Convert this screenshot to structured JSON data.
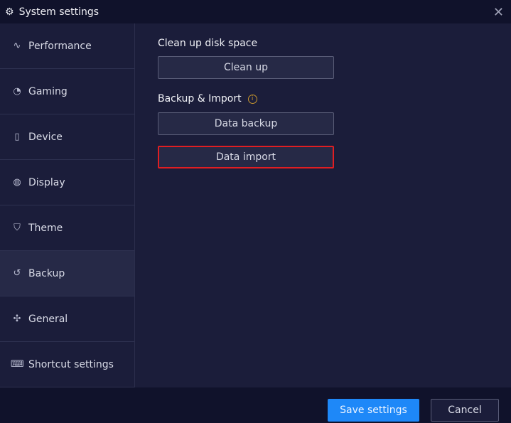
{
  "window": {
    "title": "System settings",
    "icon": "gear-icon",
    "close_icon": "close-icon"
  },
  "sidebar": {
    "selected": "Backup",
    "items": [
      {
        "label": "Performance",
        "icon": "pulse-icon"
      },
      {
        "label": "Gaming",
        "icon": "gamepad-icon"
      },
      {
        "label": "Device",
        "icon": "device-icon"
      },
      {
        "label": "Display",
        "icon": "palette-icon"
      },
      {
        "label": "Theme",
        "icon": "shirt-icon"
      },
      {
        "label": "Backup",
        "icon": "history-icon"
      },
      {
        "label": "General",
        "icon": "puzzle-icon"
      },
      {
        "label": "Shortcut settings",
        "icon": "keyboard-icon"
      }
    ]
  },
  "main": {
    "cleanup": {
      "heading": "Clean up disk space",
      "button": "Clean up"
    },
    "backup": {
      "heading": "Backup & Import",
      "info_icon": "info-icon",
      "backup_button": "Data backup",
      "import_button": "Data import"
    }
  },
  "footer": {
    "save": "Save settings",
    "cancel": "Cancel"
  },
  "colors": {
    "accent": "#1e88f8",
    "highlight": "#e01e22",
    "info": "#c8962e"
  }
}
